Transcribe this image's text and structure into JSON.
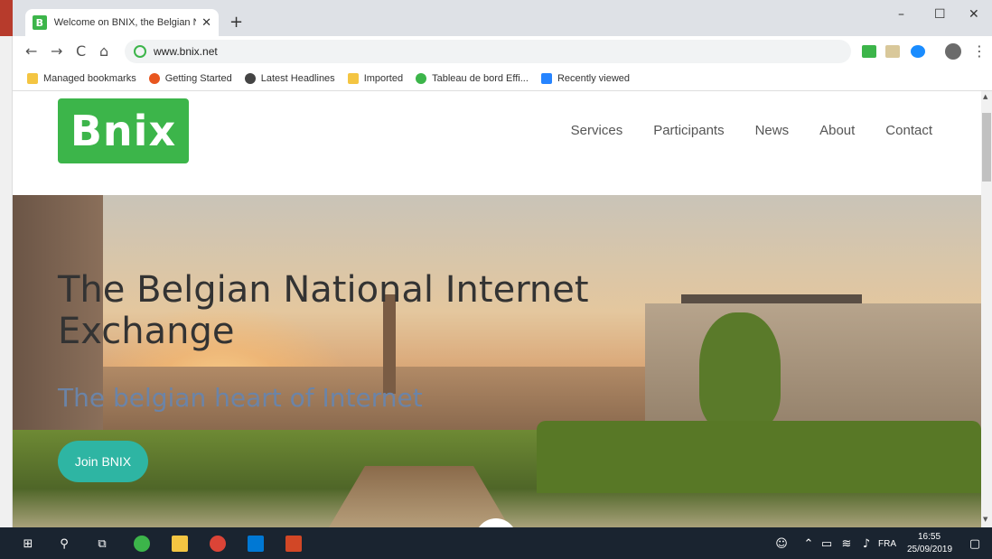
{
  "browser": {
    "tab_title": "Welcome on BNIX, the Belgian N",
    "tab_favicon_letter": "B",
    "tab_close": "✕",
    "new_tab": "+",
    "url": "www.bnix.net",
    "window_controls": {
      "minimize": "–",
      "maximize": "☐",
      "close": "✕"
    },
    "nav": {
      "back": "←",
      "forward": "→",
      "reload": "C",
      "home": "⌂"
    },
    "menu": "⋮",
    "bookmarks": [
      {
        "label": "Managed bookmarks",
        "icon": "folder-icon",
        "color": "#f4c542"
      },
      {
        "label": "Getting Started",
        "icon": "firefox-icon",
        "color": "#e8561f"
      },
      {
        "label": "Latest Headlines",
        "icon": "globe-icon",
        "color": "#444444"
      },
      {
        "label": "Imported",
        "icon": "folder-icon",
        "color": "#f4c542"
      },
      {
        "label": "Tableau de bord Effi...",
        "icon": "leaf-icon",
        "color": "#3cb54a"
      },
      {
        "label": "Recently viewed",
        "icon": "confluence-icon",
        "color": "#2684ff"
      }
    ]
  },
  "site": {
    "logo": "Bnix",
    "nav": [
      "Services",
      "Participants",
      "News",
      "About",
      "Contact"
    ],
    "hero_title": "The Belgian National Internet Exchange",
    "hero_subtitle": "The belgian heart of Internet",
    "cta": "Join BNIX"
  },
  "taskbar": {
    "language": "FRA",
    "time": "16:55",
    "date": "25/09/2019"
  },
  "colors": {
    "brand_green": "#3cb54a",
    "cta_teal": "#2eb5a3",
    "taskbar": "#1a2430"
  }
}
